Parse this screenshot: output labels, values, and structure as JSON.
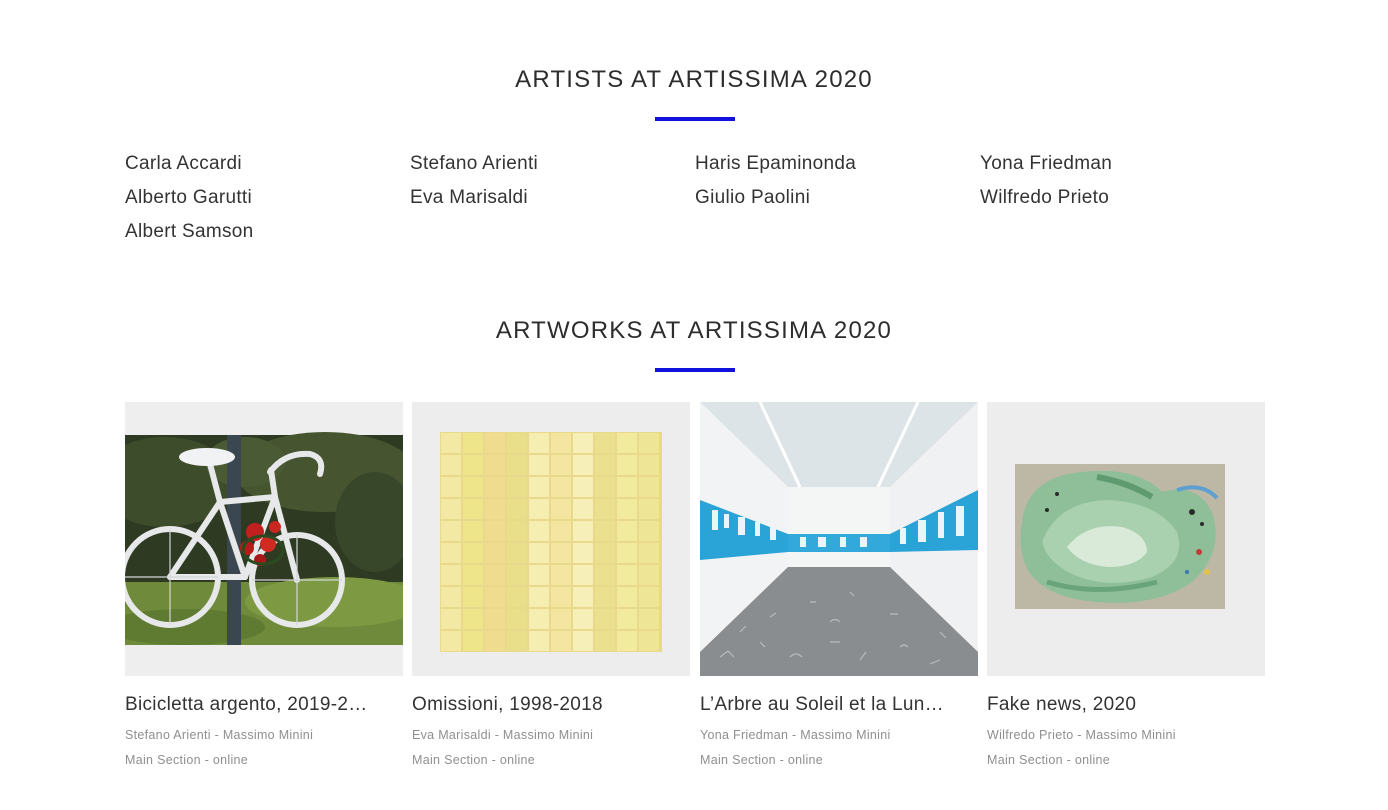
{
  "artists_section": {
    "title": "ARTISTS AT ARTISSIMA 2020",
    "accent_color": "#1212dd",
    "artists": [
      "Carla Accardi",
      "Stefano Arienti",
      "Haris Epaminonda",
      "Yona Friedman",
      "Alberto Garutti",
      "Eva Marisaldi",
      "Giulio Paolini",
      "Wilfredo Prieto",
      "Albert Samson"
    ]
  },
  "artworks_section": {
    "title": "ARTWORKS AT ARTISSIMA 2020",
    "accent_color": "#1212dd",
    "artworks": [
      {
        "title": "Bicicletta argento, 2019-2…",
        "artist_gallery": "Stefano Arienti - Massimo Minini",
        "section": "Main Section - online"
      },
      {
        "title": "Omissioni, 1998-2018",
        "artist_gallery": "Eva Marisaldi - Massimo Minini",
        "section": "Main Section - online"
      },
      {
        "title": "L’Arbre au Soleil et la Lun…",
        "artist_gallery": "Yona Friedman - Massimo Minini",
        "section": "Main Section - online"
      },
      {
        "title": "Fake news, 2020",
        "artist_gallery": "Wilfredo Prieto - Massimo Minini",
        "section": "Main Section - online"
      }
    ]
  }
}
